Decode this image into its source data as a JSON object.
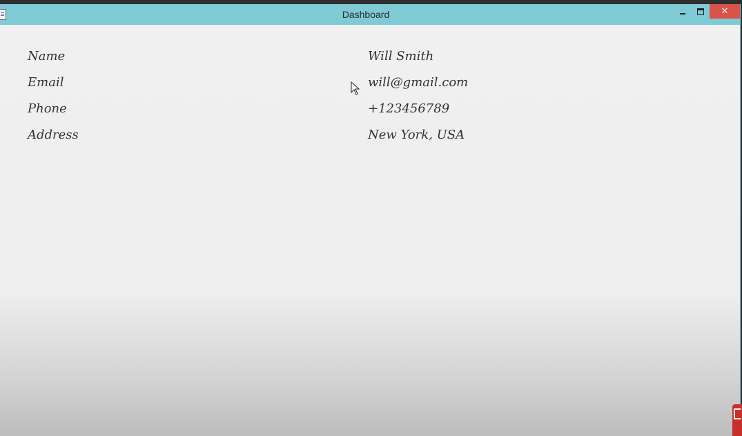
{
  "window": {
    "title": "Dashboard",
    "close_glyph": "✕"
  },
  "profile": {
    "fields": [
      {
        "label": "Name",
        "value": "Will Smith"
      },
      {
        "label": "Email",
        "value": "will@gmail.com"
      },
      {
        "label": "Phone",
        "value": "+123456789"
      },
      {
        "label": "Address",
        "value": "New York, USA"
      }
    ]
  },
  "colors": {
    "titlebar": "#7ecbd5",
    "close_button": "#d9534a",
    "text": "#333333",
    "background": "#f0f0f0"
  },
  "icons": {
    "app": "java-app-icon",
    "minimize": "minimize-icon",
    "maximize": "maximize-icon",
    "close": "close-icon",
    "cursor": "mouse-pointer-icon"
  }
}
